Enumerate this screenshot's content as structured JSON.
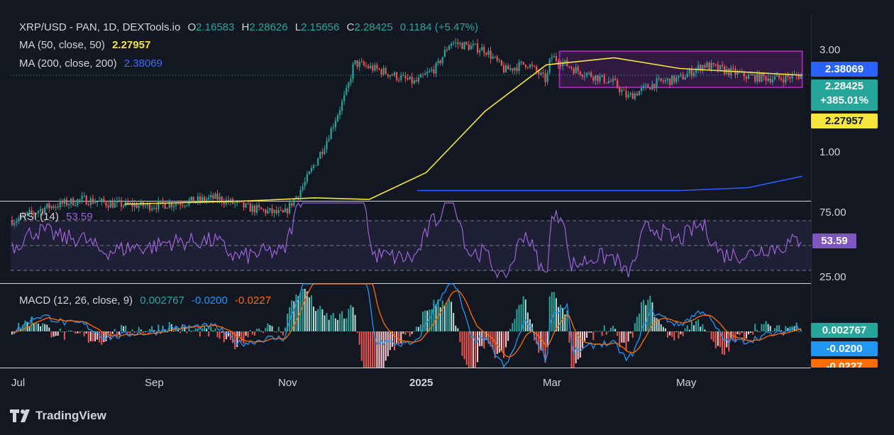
{
  "header": {
    "symbol": "XRP/USD - PAN, 1D, DEXTools.io",
    "o_label": "O",
    "o_value": "2.16583",
    "h_label": "H",
    "h_value": "2.28626",
    "l_label": "L",
    "l_value": "2.15656",
    "c_label": "C",
    "c_value": "2.28425",
    "change": "0.1184 (+5.47%)"
  },
  "ma50": {
    "label": "MA (50, close, 50)",
    "value": "2.27957",
    "color": "#f5e63d"
  },
  "ma200": {
    "label": "MA (200, close, 200)",
    "value": "2.38069",
    "color": "#2a5cff"
  },
  "rsi": {
    "label": "RSI (14)",
    "value": "53.59",
    "color": "#9c64d8",
    "levels": [
      "75.00",
      "25.00"
    ]
  },
  "macd": {
    "label": "MACD (12, 26, close, 9)",
    "macd_value": "0.002767",
    "signal_value": "-0.0200",
    "hist_value": "-0.0227"
  },
  "price_axis": {
    "labels": [
      "3.00",
      "1.00"
    ]
  },
  "price_tags": {
    "ma200": "2.38069",
    "close": "2.28425",
    "change_pct": "+385.01%",
    "ma50": "2.27957"
  },
  "rsi_tag": "53.59",
  "macd_tags": {
    "macd": "0.002767",
    "signal": "-0.0200",
    "hist": "-0.0227"
  },
  "time_axis": [
    "Jul",
    "Sep",
    "Nov",
    "2025",
    "Mar",
    "May"
  ],
  "brand": "TradingView",
  "colors": {
    "up": "#26a69a",
    "down": "#ef5350",
    "bg": "#131722",
    "box": "#9c27b0"
  },
  "chart_data": {
    "type": "candlestick",
    "x_range": [
      "2024-06-29",
      "2025-06-30"
    ],
    "price_scale": "log",
    "price_range_approx": [
      0.45,
      3.4
    ],
    "close_series_approx": [
      {
        "x": "2024-07-01",
        "y": 0.48
      },
      {
        "x": "2024-07-15",
        "y": 0.55
      },
      {
        "x": "2024-08-01",
        "y": 0.6
      },
      {
        "x": "2024-08-15",
        "y": 0.57
      },
      {
        "x": "2024-09-01",
        "y": 0.56
      },
      {
        "x": "2024-09-15",
        "y": 0.58
      },
      {
        "x": "2024-10-01",
        "y": 0.61
      },
      {
        "x": "2024-10-15",
        "y": 0.55
      },
      {
        "x": "2024-11-01",
        "y": 0.51
      },
      {
        "x": "2024-11-10",
        "y": 0.7
      },
      {
        "x": "2024-11-20",
        "y": 1.1
      },
      {
        "x": "2024-11-30",
        "y": 1.95
      },
      {
        "x": "2024-12-03",
        "y": 2.6
      },
      {
        "x": "2024-12-15",
        "y": 2.4
      },
      {
        "x": "2024-12-31",
        "y": 2.1
      },
      {
        "x": "2025-01-10",
        "y": 2.5
      },
      {
        "x": "2025-01-16",
        "y": 3.25
      },
      {
        "x": "2025-02-01",
        "y": 3.0
      },
      {
        "x": "2025-02-10",
        "y": 2.4
      },
      {
        "x": "2025-02-20",
        "y": 2.6
      },
      {
        "x": "2025-03-01",
        "y": 2.15
      },
      {
        "x": "2025-03-03",
        "y": 2.8
      },
      {
        "x": "2025-03-15",
        "y": 2.4
      },
      {
        "x": "2025-04-01",
        "y": 2.1
      },
      {
        "x": "2025-04-07",
        "y": 1.8
      },
      {
        "x": "2025-04-20",
        "y": 2.1
      },
      {
        "x": "2025-05-01",
        "y": 2.2
      },
      {
        "x": "2025-05-12",
        "y": 2.55
      },
      {
        "x": "2025-06-01",
        "y": 2.25
      },
      {
        "x": "2025-06-15",
        "y": 2.2
      },
      {
        "x": "2025-06-26",
        "y": 2.28425
      }
    ],
    "ma50_approx": [
      {
        "x": "2024-08-20",
        "y": 0.57
      },
      {
        "x": "2024-10-15",
        "y": 0.59
      },
      {
        "x": "2024-11-15",
        "y": 0.61
      },
      {
        "x": "2024-12-10",
        "y": 0.6
      },
      {
        "x": "2025-01-05",
        "y": 0.8
      },
      {
        "x": "2025-02-01",
        "y": 1.55
      },
      {
        "x": "2025-03-01",
        "y": 2.55
      },
      {
        "x": "2025-04-01",
        "y": 2.75
      },
      {
        "x": "2025-05-01",
        "y": 2.45
      },
      {
        "x": "2025-06-26",
        "y": 2.27957
      }
    ],
    "ma200_approx": [
      {
        "x": "2025-01-01",
        "y": 0.66
      },
      {
        "x": "2025-03-01",
        "y": 0.66
      },
      {
        "x": "2025-05-01",
        "y": 0.66
      },
      {
        "x": "2025-06-01",
        "y": 0.68
      },
      {
        "x": "2025-06-26",
        "y": 0.77
      }
    ],
    "consolidation_box": {
      "x_start": "2025-03-07",
      "x_end": "2025-06-26",
      "y_high": 2.95,
      "y_low": 2.0
    },
    "rsi_levels": [
      75,
      50,
      25
    ],
    "rsi_last": 53.59
  }
}
